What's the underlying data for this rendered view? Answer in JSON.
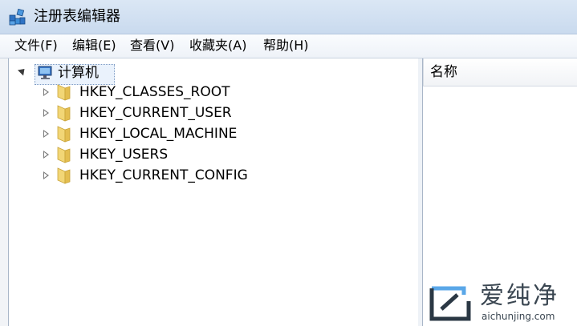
{
  "window": {
    "title": "注册表编辑器"
  },
  "menu": [
    "文件(F)",
    "编辑(E)",
    "查看(V)",
    "收藏夹(A)",
    "帮助(H)"
  ],
  "tree": {
    "root_label": "计算机",
    "keys": [
      "HKEY_CLASSES_ROOT",
      "HKEY_CURRENT_USER",
      "HKEY_LOCAL_MACHINE",
      "HKEY_USERS",
      "HKEY_CURRENT_CONFIG"
    ]
  },
  "list": {
    "column_name": "名称"
  },
  "watermark": {
    "brand": "爱纯净",
    "url": "aichunjing.com"
  },
  "icons": {
    "app": "registry-editor-icon",
    "root": "computer-icon",
    "key": "folder-icon",
    "expander": "triangle-icon"
  },
  "colors": {
    "folder": "#e8c45a",
    "titlebar": "#d6e4f4",
    "selection_border": "#7d9bc4"
  }
}
